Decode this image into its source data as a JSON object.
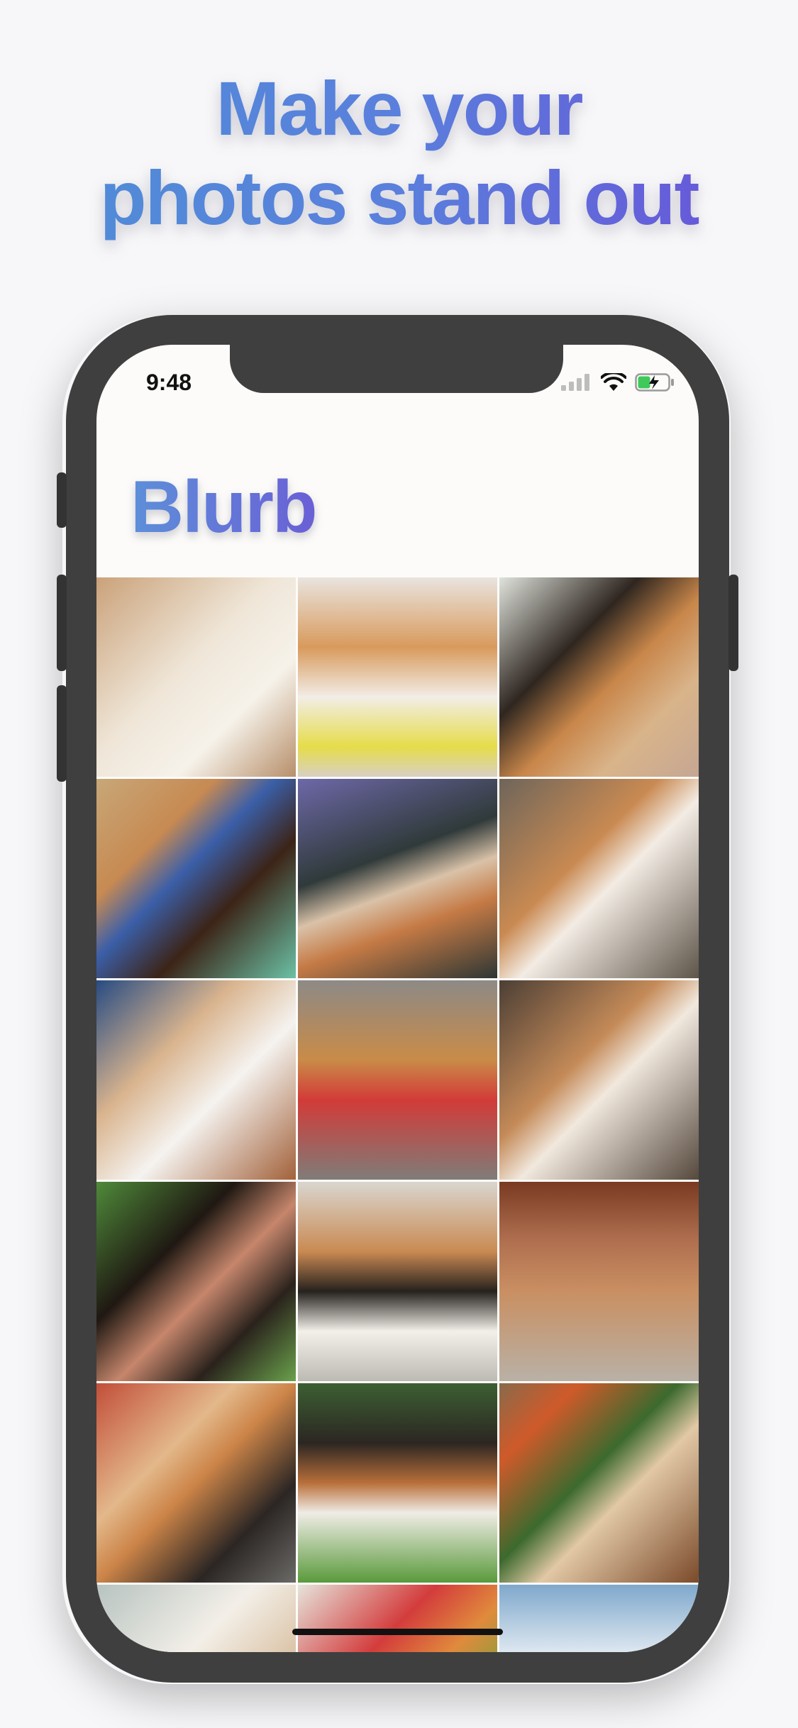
{
  "headline": {
    "line1": "Make your",
    "line2": "photos stand out",
    "gradient_start": "#4e8fd6",
    "gradient_end": "#6a4fd8"
  },
  "status_bar": {
    "time": "9:48",
    "icons": [
      "signal-icon",
      "wifi-icon",
      "battery-charging-icon"
    ]
  },
  "app": {
    "title": "Blurb"
  },
  "photos": [
    {
      "name": "photo-two-samoyeds",
      "bg": "linear-gradient(135deg,#caa27a 0%,#efe6d8 45%,#f6f2ea 70%,#b78f6a 100%)"
    },
    {
      "name": "photo-shiba-wink-bandana",
      "bg": "linear-gradient(180deg,#e9e4df 0%,#d89a5c 35%,#f2ede6 60%,#e6dc4a 85%,#d8d0c4 100%)"
    },
    {
      "name": "photo-two-shibas-talking",
      "bg": "linear-gradient(135deg,#dfe3dc 0%,#2f2620 35%,#c8864a 55%,#d9b48a 75%,#c5a693 100%)"
    },
    {
      "name": "photo-two-dachshunds",
      "bg": "linear-gradient(135deg,#c7a778 0%,#c78a52 30%,#3b5fa8 45%,#3c2417 65%,#6bc1a5 100%)"
    },
    {
      "name": "photo-shiba-blanket",
      "bg": "linear-gradient(160deg,#6d68a8 0%,#303a3a 40%,#d9c2a8 55%,#c57a45 70%,#2d3634 100%)"
    },
    {
      "name": "photo-corgi-ground",
      "bg": "linear-gradient(135deg,#6e655a 0%,#c98a52 40%,#f3ece4 55%,#5e5549 100%)"
    },
    {
      "name": "photo-puppies-samoyed",
      "bg": "linear-gradient(135deg,#274b82 0%,#d9b48e 35%,#f5f3f0 60%,#a2613a 100%)"
    },
    {
      "name": "photo-shiba-red-leash",
      "bg": "linear-gradient(180deg,#8d8a86 0%,#c98b48 40%,#d23b38 60%,#7f7c78 100%)"
    },
    {
      "name": "photo-corgi-leash",
      "bg": "linear-gradient(135deg,#4c3f35 0%,#c48a58 40%,#f1e8de 55%,#55483d 100%)"
    },
    {
      "name": "photo-dachshund-closeup",
      "bg": "linear-gradient(135deg,#4f8a3a 0%,#1f1812 35%,#c6866c 55%,#2a221c 75%,#6aa14c 100%)"
    },
    {
      "name": "photo-shibas-stairs",
      "bg": "linear-gradient(180deg,#d9d6d0 0%,#c98a52 35%,#26221e 55%,#f3f0ea 75%,#bdbab4 100%)"
    },
    {
      "name": "photo-shibas-plaza",
      "bg": "linear-gradient(180deg,#7a3a22 0%,#b07050 30%,#c98f62 55%,#b9b1a6 100%)"
    },
    {
      "name": "photo-shiba-costume",
      "bg": "linear-gradient(135deg,#c24e3a 0%,#e3b88a 35%,#cc8448 50%,#2b2624 75%,#6b6a67 100%)"
    },
    {
      "name": "photo-sheltie-grass",
      "bg": "linear-gradient(180deg,#3c5f33 0%,#2c2622 30%,#b86f3a 50%,#f0ece6 65%,#5a9a3b 100%)"
    },
    {
      "name": "photo-shiba-dino-costume",
      "bg": "linear-gradient(135deg,#8a6a4a 0%,#cf5a2a 20%,#3c6a2e 45%,#e2c8a6 60%,#7a4a2a 100%)"
    },
    {
      "name": "photo-white-shiba",
      "bg": "linear-gradient(135deg,#b7c3c0 0%,#f3efe8 40%,#d8bfa0 70%,#9c8b76 100%)"
    },
    {
      "name": "photo-balloons",
      "bg": "linear-gradient(135deg,#e6e4dc 0%,#d33c3c 35%,#e08a3c 55%,#67a63a 80%,#2e6b9a 100%)"
    },
    {
      "name": "photo-sky-clouds",
      "bg": "linear-gradient(180deg,#7fa8cc 0%,#eef3f7 40%,#9fb7c7 70%,#5c6a72 100%)"
    }
  ]
}
